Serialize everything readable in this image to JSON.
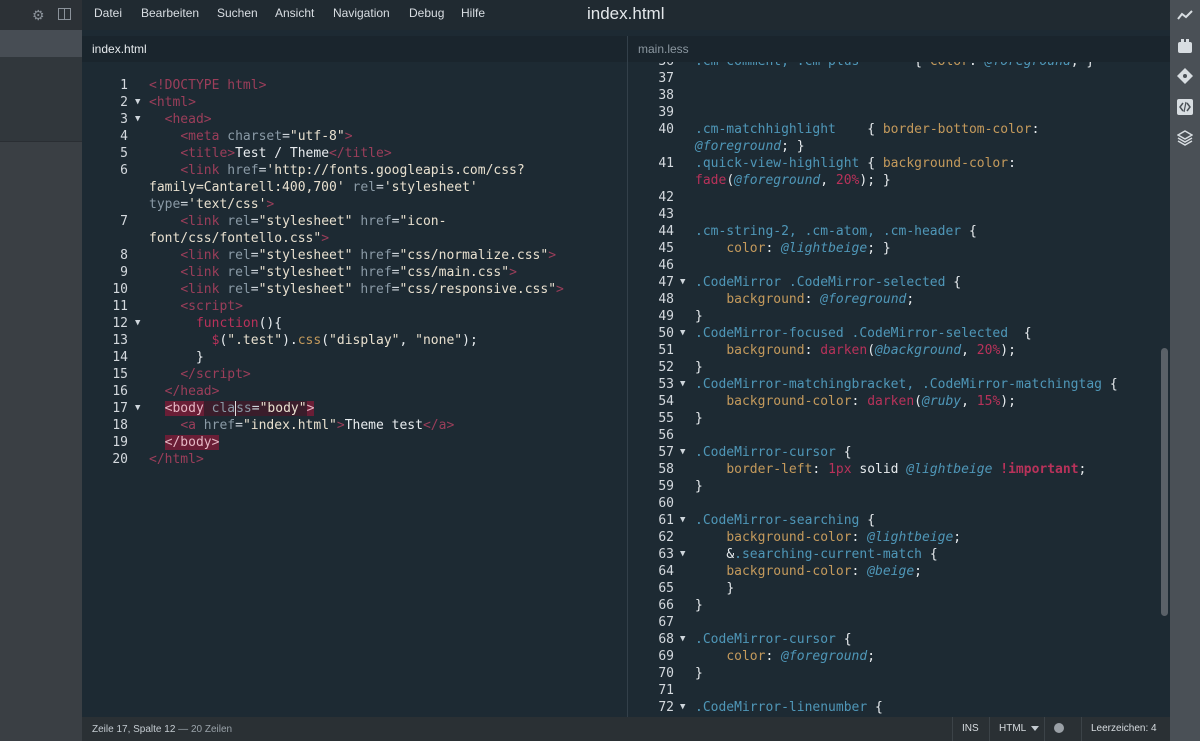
{
  "window": {
    "title": "index.html"
  },
  "menu": [
    "Datei",
    "Bearbeiten",
    "Suchen",
    "Ansicht",
    "Navigation",
    "Debug",
    "Hilfe"
  ],
  "sidebar": {
    "icons": [
      "gear-icon",
      "split-view-icon"
    ]
  },
  "tabs": {
    "left": "index.html",
    "right": "main.less"
  },
  "left_code": [
    {
      "n": "1",
      "fold": false,
      "html": "<span class='t-tag'>&lt;!DOCTYPE html&gt;</span>"
    },
    {
      "n": "2",
      "fold": true,
      "html": "<span class='t-tag'>&lt;html&gt;</span>"
    },
    {
      "n": "3",
      "fold": true,
      "html": "  <span class='t-tag'>&lt;head&gt;</span>"
    },
    {
      "n": "4",
      "fold": false,
      "html": "    <span class='t-tag'>&lt;meta</span> <span class='t-attr'>charset</span>=<span class='t-str'>\"utf-8\"</span><span class='t-tag'>&gt;</span>"
    },
    {
      "n": "5",
      "fold": false,
      "html": "    <span class='t-tag'>&lt;title&gt;</span><span class='t-plain'>Test / Theme</span><span class='t-tag'>&lt;/title&gt;</span>"
    },
    {
      "n": "6",
      "fold": false,
      "html": "    <span class='t-tag'>&lt;link</span> <span class='t-attr'>href</span>=<span class='t-str'>'http://fonts.googleapis.com/css?</span>"
    },
    {
      "n": "",
      "fold": false,
      "html": "<span class='t-str'>family=Cantarell:400,700'</span> <span class='t-attr'>rel</span>=<span class='t-str'>'stylesheet'</span>"
    },
    {
      "n": "",
      "fold": false,
      "html": "<span class='t-attr'>type</span>=<span class='t-str'>'text/css'</span><span class='t-tag'>&gt;</span>"
    },
    {
      "n": "7",
      "fold": false,
      "html": "    <span class='t-tag'>&lt;link</span> <span class='t-attr'>rel</span>=<span class='t-str'>\"stylesheet\"</span> <span class='t-attr'>href</span>=<span class='t-str'>\"icon-</span>"
    },
    {
      "n": "",
      "fold": false,
      "html": "<span class='t-str'>font/css/fontello.css\"</span><span class='t-tag'>&gt;</span>"
    },
    {
      "n": "8",
      "fold": false,
      "html": "    <span class='t-tag'>&lt;link</span> <span class='t-attr'>rel</span>=<span class='t-str'>\"stylesheet\"</span> <span class='t-attr'>href</span>=<span class='t-str'>\"css/normalize.css\"</span><span class='t-tag'>&gt;</span>"
    },
    {
      "n": "9",
      "fold": false,
      "html": "    <span class='t-tag'>&lt;link</span> <span class='t-attr'>rel</span>=<span class='t-str'>\"stylesheet\"</span> <span class='t-attr'>href</span>=<span class='t-str'>\"css/main.css\"</span><span class='t-tag'>&gt;</span>"
    },
    {
      "n": "10",
      "fold": false,
      "html": "    <span class='t-tag'>&lt;link</span> <span class='t-attr'>rel</span>=<span class='t-str'>\"stylesheet\"</span> <span class='t-attr'>href</span>=<span class='t-str'>\"css/responsive.css\"</span><span class='t-tag'>&gt;</span>"
    },
    {
      "n": "11",
      "fold": false,
      "html": "    <span class='t-tag'>&lt;script&gt;</span>"
    },
    {
      "n": "12",
      "fold": true,
      "html": "      <span class='t-kw'>function</span><span class='t-plain'>(){</span>"
    },
    {
      "n": "13",
      "fold": false,
      "html": "        <span class='t-kw'>$</span><span class='t-plain'>(</span><span class='t-str'>\".test\"</span><span class='t-plain'>).</span><span class='t-prop'>css</span><span class='t-plain'>(</span><span class='t-str'>\"display\"</span><span class='t-plain'>, </span><span class='t-str'>\"none\"</span><span class='t-plain'>);</span>"
    },
    {
      "n": "14",
      "fold": false,
      "html": "      <span class='t-plain'>}</span>"
    },
    {
      "n": "15",
      "fold": false,
      "html": "    <span class='t-tag'>&lt;/script&gt;</span>"
    },
    {
      "n": "16",
      "fold": false,
      "html": "  <span class='t-tag'>&lt;/head&gt;</span>"
    },
    {
      "n": "17",
      "fold": true,
      "html": "  <span class='t-hltag'>&lt;body</span><span class='hl-row'> <span class='t-attr'>cla</span><span class='t-attr' style='border-left:1px solid #e0e0e0'>ss</span>=<span class='t-str'>\"body\"</span></span><span class='t-hltag'>&gt;</span>"
    },
    {
      "n": "18",
      "fold": false,
      "html": "    <span class='t-tag'>&lt;a</span> <span class='t-attr'>href</span>=<span class='t-str'>\"index.html\"</span><span class='t-tag'>&gt;</span><span class='t-plain'>Theme test</span><span class='t-tag'>&lt;/a&gt;</span>"
    },
    {
      "n": "19",
      "fold": false,
      "html": "  <span class='t-hltag'>&lt;/body&gt;</span>"
    },
    {
      "n": "20",
      "fold": false,
      "html": "<span class='t-tag'>&lt;/html&gt;</span>"
    }
  ],
  "right_code": [
    {
      "n": "36",
      "fold": false,
      "html": "<span class='t-sel'>.cm-comment, .cm-plus</span>       <span class='t-plain'>{ </span><span class='t-prop'>color</span><span class='t-plain'>: </span><span class='t-var'>@foreground</span><span class='t-plain'>; }</span>"
    },
    {
      "n": "37",
      "fold": false,
      "html": ""
    },
    {
      "n": "38",
      "fold": false,
      "html": ""
    },
    {
      "n": "39",
      "fold": false,
      "html": ""
    },
    {
      "n": "40",
      "fold": false,
      "html": "<span class='t-sel'>.cm-matchhighlight</span>    <span class='t-plain'>{ </span><span class='t-prop'>border-bottom-color</span><span class='t-plain'>:</span>"
    },
    {
      "n": "",
      "fold": false,
      "html": "<span class='t-var'>@foreground</span><span class='t-plain'>; }</span>"
    },
    {
      "n": "41",
      "fold": false,
      "html": "<span class='t-sel'>.quick-view-highlight</span> <span class='t-plain'>{ </span><span class='t-prop'>background-color</span><span class='t-plain'>:</span>"
    },
    {
      "n": "",
      "fold": false,
      "html": "<span class='t-fn'>fade</span><span class='t-plain'>(</span><span class='t-var'>@foreground</span><span class='t-plain'>, </span><span class='t-num'>20%</span><span class='t-plain'>); }</span>"
    },
    {
      "n": "42",
      "fold": false,
      "html": ""
    },
    {
      "n": "43",
      "fold": false,
      "html": ""
    },
    {
      "n": "44",
      "fold": false,
      "html": "<span class='t-sel'>.cm-string-2, .cm-atom, .cm-header</span> <span class='t-plain'>{</span>"
    },
    {
      "n": "45",
      "fold": false,
      "html": "    <span class='t-prop'>color</span><span class='t-plain'>: </span><span class='t-var'>@lightbeige</span><span class='t-plain'>; }</span>"
    },
    {
      "n": "46",
      "fold": false,
      "html": ""
    },
    {
      "n": "47",
      "fold": true,
      "html": "<span class='t-sel'>.CodeMirror .CodeMirror-selected</span> <span class='t-plain'>{</span>"
    },
    {
      "n": "48",
      "fold": false,
      "html": "    <span class='t-prop'>background</span><span class='t-plain'>: </span><span class='t-var'>@foreground</span><span class='t-plain'>;</span>"
    },
    {
      "n": "49",
      "fold": false,
      "html": "<span class='t-plain'>}</span>"
    },
    {
      "n": "50",
      "fold": true,
      "html": "<span class='t-sel'>.CodeMirror-focused .CodeMirror-selected</span>  <span class='t-plain'>{</span>"
    },
    {
      "n": "51",
      "fold": false,
      "html": "    <span class='t-prop'>background</span><span class='t-plain'>: </span><span class='t-fn'>darken</span><span class='t-plain'>(</span><span class='t-var'>@background</span><span class='t-plain'>, </span><span class='t-num'>20%</span><span class='t-plain'>);</span>"
    },
    {
      "n": "52",
      "fold": false,
      "html": "<span class='t-plain'>}</span>"
    },
    {
      "n": "53",
      "fold": true,
      "html": "<span class='t-sel'>.CodeMirror-matchingbracket, .CodeMirror-matchingtag</span> <span class='t-plain'>{</span>"
    },
    {
      "n": "54",
      "fold": false,
      "html": "    <span class='t-prop'>background-color</span><span class='t-plain'>: </span><span class='t-fn'>darken</span><span class='t-plain'>(</span><span class='t-var'>@ruby</span><span class='t-plain'>, </span><span class='t-num'>15%</span><span class='t-plain'>);</span>"
    },
    {
      "n": "55",
      "fold": false,
      "html": "<span class='t-plain'>}</span>"
    },
    {
      "n": "56",
      "fold": false,
      "html": ""
    },
    {
      "n": "57",
      "fold": true,
      "html": "<span class='t-sel'>.CodeMirror-cursor</span> <span class='t-plain'>{</span>"
    },
    {
      "n": "58",
      "fold": false,
      "html": "    <span class='t-prop'>border-left</span><span class='t-plain'>: </span><span class='t-num'>1px</span> <span class='t-plain'>solid</span> <span class='t-var'>@lightbeige</span> <span class='t-imp'>!important</span><span class='t-plain'>;</span>"
    },
    {
      "n": "59",
      "fold": false,
      "html": "<span class='t-plain'>}</span>"
    },
    {
      "n": "60",
      "fold": false,
      "html": ""
    },
    {
      "n": "61",
      "fold": true,
      "html": "<span class='t-sel'>.CodeMirror-searching</span> <span class='t-plain'>{</span>"
    },
    {
      "n": "62",
      "fold": false,
      "html": "    <span class='t-prop'>background-color</span><span class='t-plain'>: </span><span class='t-var'>@lightbeige</span><span class='t-plain'>;</span>"
    },
    {
      "n": "63",
      "fold": true,
      "html": "    <span class='t-plain'>&amp;</span><span class='t-sel'>.searching-current-match</span> <span class='t-plain'>{</span>"
    },
    {
      "n": "64",
      "fold": false,
      "html": "    <span class='t-prop'>background-color</span><span class='t-plain'>: </span><span class='t-var'>@beige</span><span class='t-plain'>;</span>"
    },
    {
      "n": "65",
      "fold": false,
      "html": "    <span class='t-plain'>}</span>"
    },
    {
      "n": "66",
      "fold": false,
      "html": "<span class='t-plain'>}</span>"
    },
    {
      "n": "67",
      "fold": false,
      "html": ""
    },
    {
      "n": "68",
      "fold": true,
      "html": "<span class='t-sel'>.CodeMirror-cursor</span> <span class='t-plain'>{</span>"
    },
    {
      "n": "69",
      "fold": false,
      "html": "    <span class='t-prop'>color</span><span class='t-plain'>: </span><span class='t-var'>@foreground</span><span class='t-plain'>;</span>"
    },
    {
      "n": "70",
      "fold": false,
      "html": "<span class='t-plain'>}</span>"
    },
    {
      "n": "71",
      "fold": false,
      "html": ""
    },
    {
      "n": "72",
      "fold": true,
      "html": "<span class='t-sel'>.CodeMirror-linenumber</span> <span class='t-plain'>{</span>"
    }
  ],
  "toolbar_right": [
    "live-preview-icon",
    "extension-manager-icon",
    "git-icon",
    "code-tag-icon",
    "layers-icon"
  ],
  "status": {
    "position": "Zeile 17, Spalte 12",
    "sep": " — ",
    "lines": "20 Zeilen",
    "mode": "INS",
    "language": "HTML",
    "indent": "Leerzeichen: 4"
  }
}
